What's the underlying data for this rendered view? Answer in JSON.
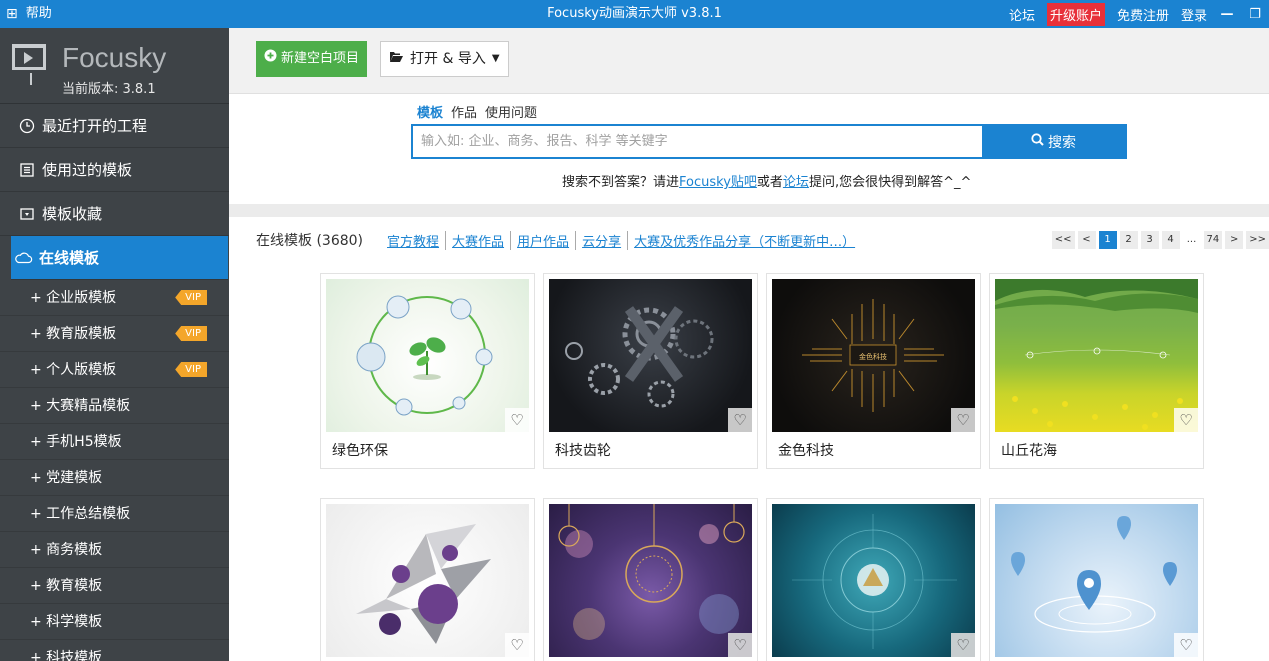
{
  "titlebar": {
    "help_label": "帮助",
    "title": "Focusky动画演示大师 v3.8.1",
    "links": [
      "论坛",
      "升级账户",
      "免费注册",
      "登录"
    ]
  },
  "sidebar": {
    "logo_name": "Focusky",
    "version": "当前版本: 3.8.1",
    "nav": [
      {
        "label": "最近打开的工程",
        "icon": "clock-icon"
      },
      {
        "label": "使用过的模板",
        "icon": "list-icon"
      },
      {
        "label": "模板收藏",
        "icon": "favorite-folder-icon"
      },
      {
        "label": "在线模板",
        "icon": "cloud-icon"
      }
    ],
    "sub": [
      {
        "label": "+ 企业版模板",
        "vip": "VIP"
      },
      {
        "label": "+ 教育版模板",
        "vip": "VIP"
      },
      {
        "label": "+ 个人版模板",
        "vip": "VIP"
      },
      {
        "label": "+ 大赛精品模板"
      },
      {
        "label": "+ 手机H5模板"
      },
      {
        "label": "+ 党建模板"
      },
      {
        "label": "+ 工作总结模板"
      },
      {
        "label": "+ 商务模板"
      },
      {
        "label": "+ 教育模板"
      },
      {
        "label": "+ 科学模板"
      },
      {
        "label": "+ 科技模板"
      }
    ]
  },
  "toolbar": {
    "new_label": "新建空白项目",
    "open_label": "打开 & 导入"
  },
  "search": {
    "tabs": [
      "模板",
      "作品",
      "使用问题"
    ],
    "placeholder": "输入如: 企业、商务、报告、科学 等关键字",
    "button": "搜索",
    "help_prefix": "搜索不到答案？请进",
    "help_link1": "Focusky贴吧",
    "help_mid": "或者",
    "help_link2": "论坛",
    "help_suffix": "提问,您会很快得到解答^_^"
  },
  "filters": {
    "count": "在线模板 (3680)",
    "links": [
      "官方教程",
      "大赛作品",
      "用户作品",
      "云分享",
      "大赛及优秀作品分享（不断更新中…）"
    ]
  },
  "pager": [
    "<<",
    "<",
    "1",
    "2",
    "3",
    "4",
    "...",
    "74",
    ">",
    ">>"
  ],
  "templates": [
    {
      "title": "绿色环保"
    },
    {
      "title": "科技齿轮"
    },
    {
      "title": "金色科技"
    },
    {
      "title": "山丘花海"
    },
    {
      "title": ""
    },
    {
      "title": ""
    },
    {
      "title": ""
    },
    {
      "title": ""
    }
  ],
  "colors": {
    "accent": "#1b83d1",
    "green": "#4dae4a",
    "upgrade": "#e8303a",
    "vip": "#f4a62a"
  }
}
